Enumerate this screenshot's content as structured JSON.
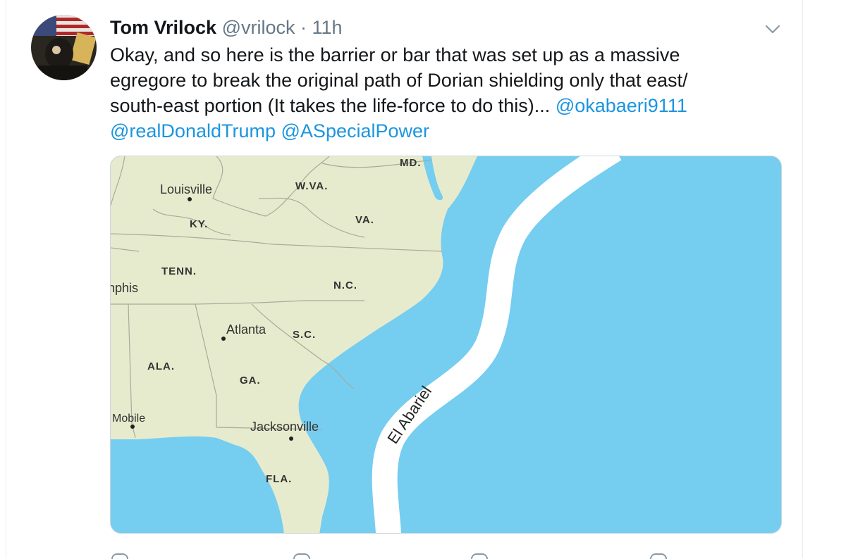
{
  "tweet": {
    "author_name": "Tom Vrilock",
    "author_handle": "@vrilock",
    "separator": "·",
    "time": "11h",
    "text_lines": [
      "Okay, and so here is the barrier or bar that was set up as a massive",
      "egregore to break the original path of Dorian shielding only that east/",
      "south-east portion (It takes the life-force to do this)..."
    ],
    "mentions": [
      "@okabaeri9111",
      "@realDonaldTrump",
      "@ASpecialPower"
    ]
  },
  "map": {
    "labels": {
      "md": "MD.",
      "wva": "W.VA.",
      "louisville": "Louisville",
      "ky": "KY.",
      "va": "VA.",
      "tenn": "TENN.",
      "memphis": "nphis",
      "nc": "N.C.",
      "atlanta": "Atlanta",
      "sc": "S.C.",
      "ala": "ALA.",
      "ga": "GA.",
      "mobile": "Mobile",
      "jacksonville": "Jacksonville",
      "fla": "FLA.",
      "barrier": "El Abariel"
    },
    "colors": {
      "land": "#e7ebcd",
      "ocean": "#75cdf0",
      "barrier": "#ffffff",
      "border": "#a9aa9a"
    }
  },
  "icons": {
    "caret": "chevron-down-icon",
    "actions": [
      "reply-icon",
      "retweet-icon",
      "like-icon",
      "share-icon"
    ]
  }
}
